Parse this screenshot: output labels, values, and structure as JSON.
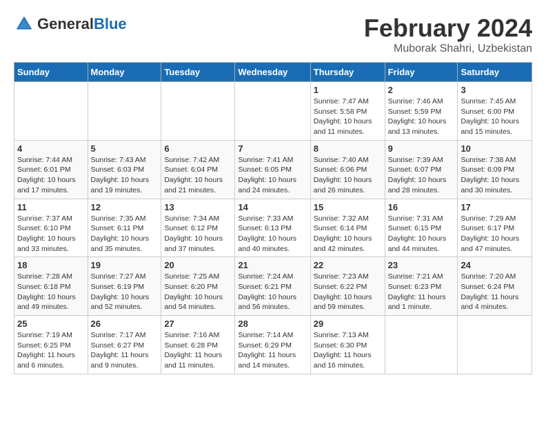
{
  "logo": {
    "text_general": "General",
    "text_blue": "Blue"
  },
  "title": {
    "month_year": "February 2024",
    "location": "Muborak Shahri, Uzbekistan"
  },
  "weekdays": [
    "Sunday",
    "Monday",
    "Tuesday",
    "Wednesday",
    "Thursday",
    "Friday",
    "Saturday"
  ],
  "weeks": [
    [
      {
        "day": "",
        "info": ""
      },
      {
        "day": "",
        "info": ""
      },
      {
        "day": "",
        "info": ""
      },
      {
        "day": "",
        "info": ""
      },
      {
        "day": "1",
        "info": "Sunrise: 7:47 AM\nSunset: 5:58 PM\nDaylight: 10 hours\nand 11 minutes."
      },
      {
        "day": "2",
        "info": "Sunrise: 7:46 AM\nSunset: 5:59 PM\nDaylight: 10 hours\nand 13 minutes."
      },
      {
        "day": "3",
        "info": "Sunrise: 7:45 AM\nSunset: 6:00 PM\nDaylight: 10 hours\nand 15 minutes."
      }
    ],
    [
      {
        "day": "4",
        "info": "Sunrise: 7:44 AM\nSunset: 6:01 PM\nDaylight: 10 hours\nand 17 minutes."
      },
      {
        "day": "5",
        "info": "Sunrise: 7:43 AM\nSunset: 6:03 PM\nDaylight: 10 hours\nand 19 minutes."
      },
      {
        "day": "6",
        "info": "Sunrise: 7:42 AM\nSunset: 6:04 PM\nDaylight: 10 hours\nand 21 minutes."
      },
      {
        "day": "7",
        "info": "Sunrise: 7:41 AM\nSunset: 6:05 PM\nDaylight: 10 hours\nand 24 minutes."
      },
      {
        "day": "8",
        "info": "Sunrise: 7:40 AM\nSunset: 6:06 PM\nDaylight: 10 hours\nand 26 minutes."
      },
      {
        "day": "9",
        "info": "Sunrise: 7:39 AM\nSunset: 6:07 PM\nDaylight: 10 hours\nand 28 minutes."
      },
      {
        "day": "10",
        "info": "Sunrise: 7:38 AM\nSunset: 6:09 PM\nDaylight: 10 hours\nand 30 minutes."
      }
    ],
    [
      {
        "day": "11",
        "info": "Sunrise: 7:37 AM\nSunset: 6:10 PM\nDaylight: 10 hours\nand 33 minutes."
      },
      {
        "day": "12",
        "info": "Sunrise: 7:35 AM\nSunset: 6:11 PM\nDaylight: 10 hours\nand 35 minutes."
      },
      {
        "day": "13",
        "info": "Sunrise: 7:34 AM\nSunset: 6:12 PM\nDaylight: 10 hours\nand 37 minutes."
      },
      {
        "day": "14",
        "info": "Sunrise: 7:33 AM\nSunset: 6:13 PM\nDaylight: 10 hours\nand 40 minutes."
      },
      {
        "day": "15",
        "info": "Sunrise: 7:32 AM\nSunset: 6:14 PM\nDaylight: 10 hours\nand 42 minutes."
      },
      {
        "day": "16",
        "info": "Sunrise: 7:31 AM\nSunset: 6:15 PM\nDaylight: 10 hours\nand 44 minutes."
      },
      {
        "day": "17",
        "info": "Sunrise: 7:29 AM\nSunset: 6:17 PM\nDaylight: 10 hours\nand 47 minutes."
      }
    ],
    [
      {
        "day": "18",
        "info": "Sunrise: 7:28 AM\nSunset: 6:18 PM\nDaylight: 10 hours\nand 49 minutes."
      },
      {
        "day": "19",
        "info": "Sunrise: 7:27 AM\nSunset: 6:19 PM\nDaylight: 10 hours\nand 52 minutes."
      },
      {
        "day": "20",
        "info": "Sunrise: 7:25 AM\nSunset: 6:20 PM\nDaylight: 10 hours\nand 54 minutes."
      },
      {
        "day": "21",
        "info": "Sunrise: 7:24 AM\nSunset: 6:21 PM\nDaylight: 10 hours\nand 56 minutes."
      },
      {
        "day": "22",
        "info": "Sunrise: 7:23 AM\nSunset: 6:22 PM\nDaylight: 10 hours\nand 59 minutes."
      },
      {
        "day": "23",
        "info": "Sunrise: 7:21 AM\nSunset: 6:23 PM\nDaylight: 11 hours\nand 1 minute."
      },
      {
        "day": "24",
        "info": "Sunrise: 7:20 AM\nSunset: 6:24 PM\nDaylight: 11 hours\nand 4 minutes."
      }
    ],
    [
      {
        "day": "25",
        "info": "Sunrise: 7:19 AM\nSunset: 6:25 PM\nDaylight: 11 hours\nand 6 minutes."
      },
      {
        "day": "26",
        "info": "Sunrise: 7:17 AM\nSunset: 6:27 PM\nDaylight: 11 hours\nand 9 minutes."
      },
      {
        "day": "27",
        "info": "Sunrise: 7:16 AM\nSunset: 6:28 PM\nDaylight: 11 hours\nand 11 minutes."
      },
      {
        "day": "28",
        "info": "Sunrise: 7:14 AM\nSunset: 6:29 PM\nDaylight: 11 hours\nand 14 minutes."
      },
      {
        "day": "29",
        "info": "Sunrise: 7:13 AM\nSunset: 6:30 PM\nDaylight: 11 hours\nand 16 minutes."
      },
      {
        "day": "",
        "info": ""
      },
      {
        "day": "",
        "info": ""
      }
    ]
  ]
}
